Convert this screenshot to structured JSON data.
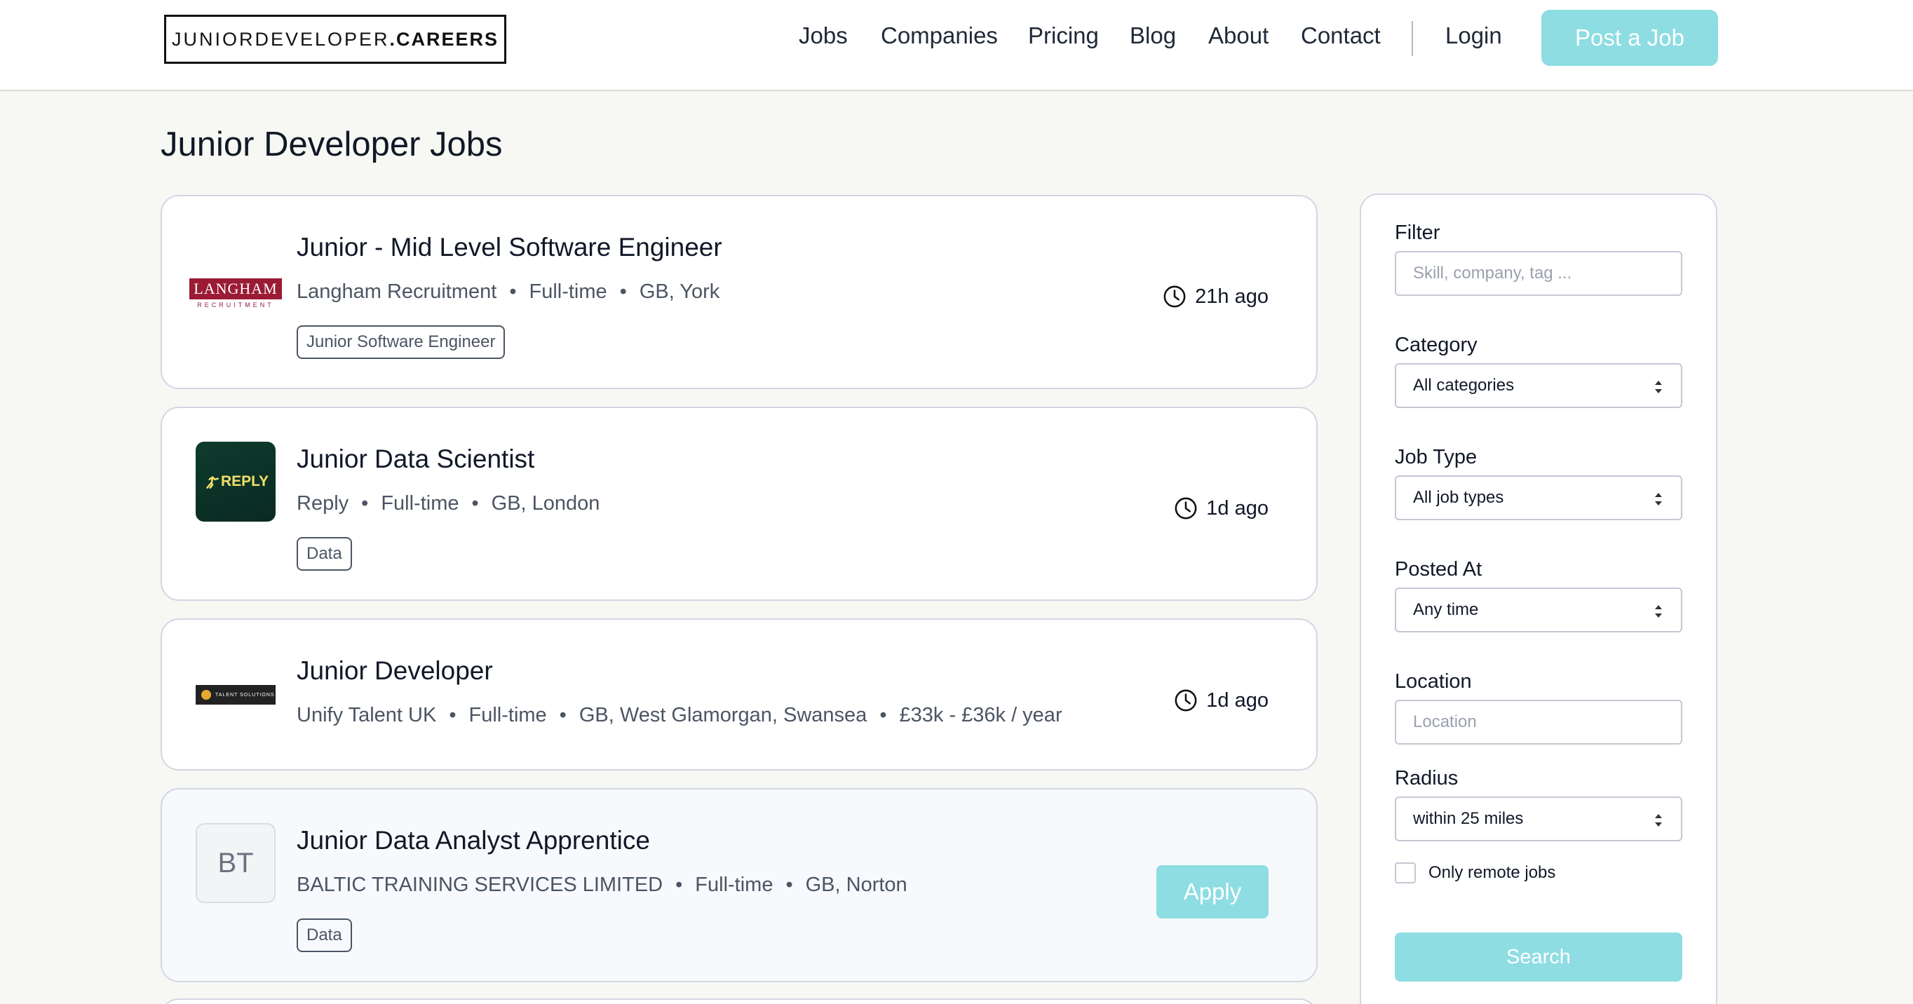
{
  "header": {
    "logo_light": "JUNIORDEVELOPER",
    "logo_bold": ".CAREERS",
    "nav": [
      "Jobs",
      "Companies",
      "Pricing",
      "Blog",
      "About",
      "Contact"
    ],
    "login": "Login",
    "post_job": "Post a Job"
  },
  "page_title": "Junior Developer Jobs",
  "jobs": [
    {
      "logo_text": "LANGHAM",
      "logo_subtext": "RECRUITMENT",
      "title": "Junior - Mid Level Software Engineer",
      "company": "Langham Recruitment",
      "type": "Full-time",
      "location": "GB, York",
      "tag": "Junior Software Engineer",
      "posted": "21h ago"
    },
    {
      "logo_text": "REPLY",
      "title": "Junior Data Scientist",
      "company": "Reply",
      "type": "Full-time",
      "location": "GB, London",
      "tag": "Data",
      "posted": "1d ago"
    },
    {
      "logo_text": "TALENT SOLUTIONS",
      "title": "Junior Developer",
      "company": "Unify Talent UK",
      "type": "Full-time",
      "location": "GB, West Glamorgan, Swansea",
      "salary": "£33k - £36k / year",
      "posted": "1d ago"
    },
    {
      "initials": "BT",
      "title": "Junior Data Analyst Apprentice",
      "company": "BALTIC TRAINING SERVICES LIMITED",
      "type": "Full-time",
      "location": "GB, Norton",
      "tag": "Data",
      "apply": "Apply"
    }
  ],
  "sidebar": {
    "filter_label": "Filter",
    "filter_placeholder": "Skill, company, tag ...",
    "category_label": "Category",
    "category_value": "All categories",
    "jobtype_label": "Job Type",
    "jobtype_value": "All job types",
    "posted_label": "Posted At",
    "posted_value": "Any time",
    "location_label": "Location",
    "location_placeholder": "Location",
    "radius_label": "Radius",
    "radius_value": "within 25 miles",
    "remote_label": "Only remote jobs",
    "search_button": "Search"
  },
  "colors": {
    "accent": "#8ddde2",
    "background": "#f7f8f4",
    "langham": "#9b1b35",
    "reply_bg": "#0e3b2d"
  }
}
